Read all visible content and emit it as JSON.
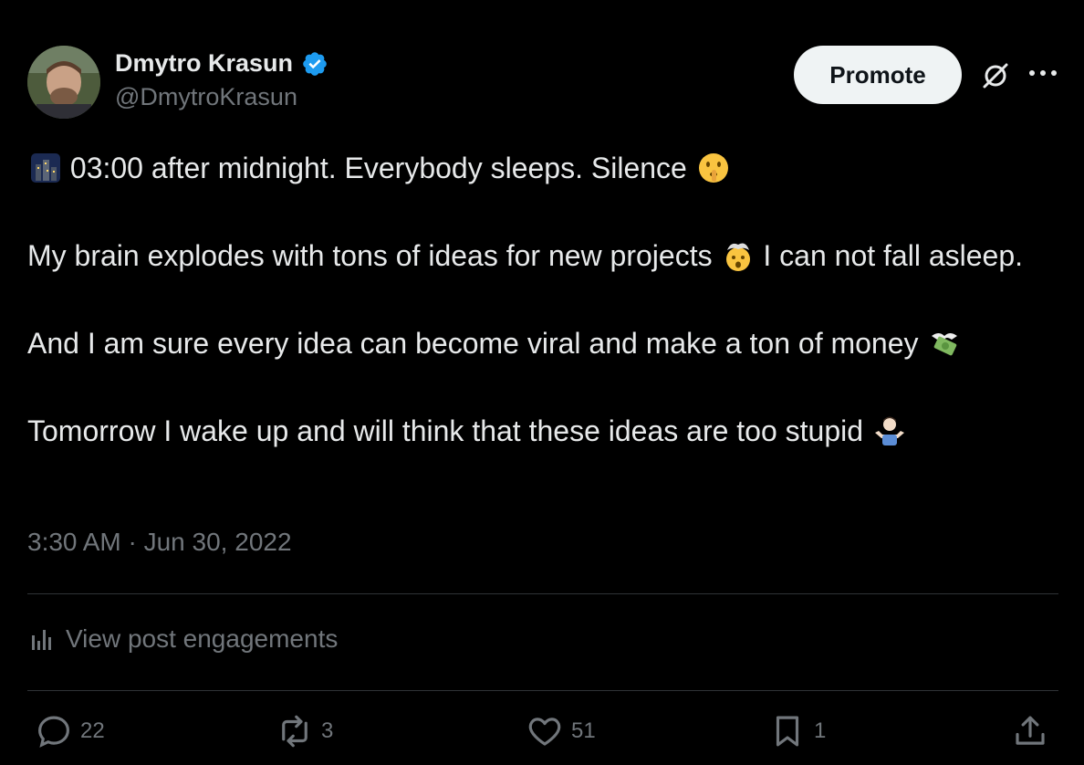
{
  "author": {
    "display_name": "Dmytro Krasun",
    "handle": "@DmytroKrasun",
    "verified": true
  },
  "header": {
    "promote_label": "Promote",
    "grok_icon": "grok-icon",
    "more_icon": "more-icon"
  },
  "post": {
    "paragraphs": [
      {
        "text": "03:00 after midnight. Everybody sleeps. Silence",
        "lead_emoji": "night-city-emoji",
        "trail_emoji": "shushing-face-emoji"
      },
      {
        "text_before": "My brain explodes with tons of ideas for new projects",
        "emoji": "exploding-head-emoji",
        "text_after": "I can not fall asleep."
      },
      {
        "text": "And I am sure every idea can become viral and make a ton of money",
        "trail_emoji": "money-with-wings-emoji"
      },
      {
        "text": "Tomorrow I wake up and will think that these ideas are too stupid",
        "trail_emoji": "person-shrugging-emoji"
      }
    ],
    "timestamp": "3:30 AM · Jun 30, 2022"
  },
  "engagements_label": "View post engagements",
  "actions": {
    "replies": "22",
    "reposts": "3",
    "likes": "51",
    "bookmarks": "1"
  },
  "colors": {
    "background": "#000000",
    "text": "#e7e9ea",
    "muted": "#71767b",
    "divider": "#2f3336",
    "verified": "#1d9bf0",
    "promote_bg": "#eff3f4"
  }
}
